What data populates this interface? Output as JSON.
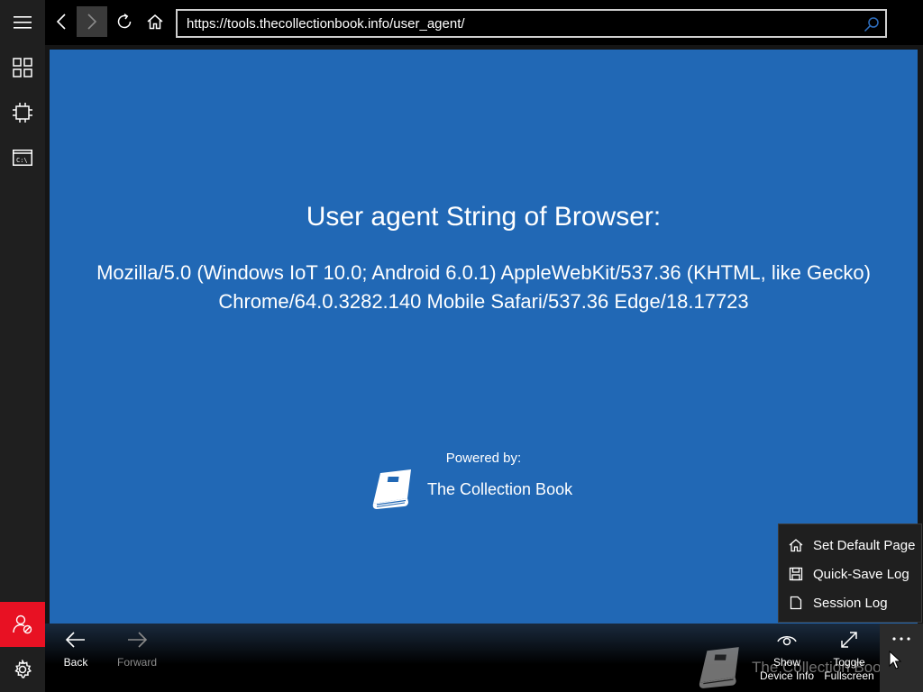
{
  "browser": {
    "url": "https://tools.thecollectionbook.info/user_agent/"
  },
  "page": {
    "heading": "User agent String of Browser:",
    "ua_line1": "Mozilla/5.0 (Windows IoT 10.0; Android 6.0.1) AppleWebKit/537.36 (KHTML, like Gecko)",
    "ua_line2": "Chrome/64.0.3282.140 Mobile Safari/537.36 Edge/18.17723",
    "powered_by": "Powered by:",
    "brand": "The Collection Book"
  },
  "context_menu": {
    "items": [
      {
        "label": "Set Default Page",
        "icon": "home-icon"
      },
      {
        "label": "Quick-Save Log",
        "icon": "save-icon"
      },
      {
        "label": "Session Log",
        "icon": "document-icon"
      }
    ]
  },
  "bottom_bar": {
    "back_label": "Back",
    "forward_label": "Forward",
    "show_label_1": "Show",
    "show_label_2": "Device Info",
    "toggle_label_1": "Toggle",
    "toggle_label_2": "Fullscreen",
    "watermark": "The Collection Book"
  },
  "left_rail": {
    "items": [
      "menu-icon",
      "apps-grid-icon",
      "processor-icon",
      "console-icon",
      "user-blocked-icon",
      "settings-icon"
    ]
  },
  "colors": {
    "content_bg": "#2168b5",
    "alert_red": "#e81123"
  }
}
